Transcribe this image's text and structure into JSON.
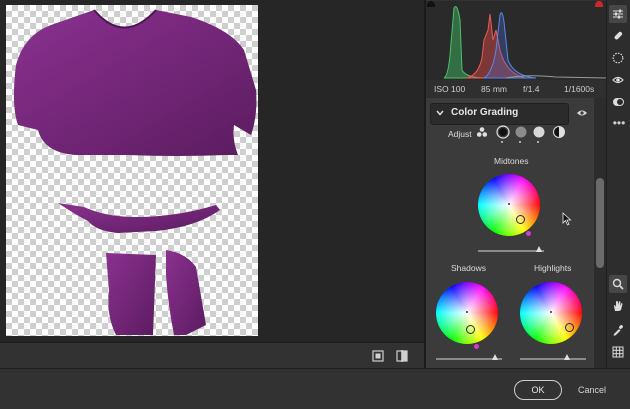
{
  "camera_info": {
    "iso": "ISO 100",
    "focal": "85 mm",
    "aperture": "f/1.4",
    "shutter": "1/1600s"
  },
  "color_grading": {
    "title": "Color Grading",
    "adjust_label": "Adjust",
    "midtones_label": "Midtones",
    "shadows_label": "Shadows",
    "highlights_label": "Highlights",
    "midtones_blend": 0.88,
    "shadows_luminance": 0.78,
    "highlights_luminance": 0.7
  },
  "buttons": {
    "ok": "OK",
    "cancel": "Cancel"
  },
  "colors": {
    "shirt": "#7b2a7e",
    "histogram_red": "#e04848",
    "histogram_green": "#3aa55a",
    "histogram_blue": "#4a72d8",
    "wheel_handle": "#d73ad6"
  },
  "icons": [
    "clipping-warning-icon",
    "edit-sliders-icon",
    "healing-brush-icon",
    "mask-icon",
    "red-eye-icon",
    "presets-icon",
    "more-icon",
    "zoom-icon",
    "hand-icon",
    "color-sampler-icon",
    "grid-icon",
    "visibility-eye-icon",
    "before-after-icon",
    "fit-view-icon"
  ]
}
